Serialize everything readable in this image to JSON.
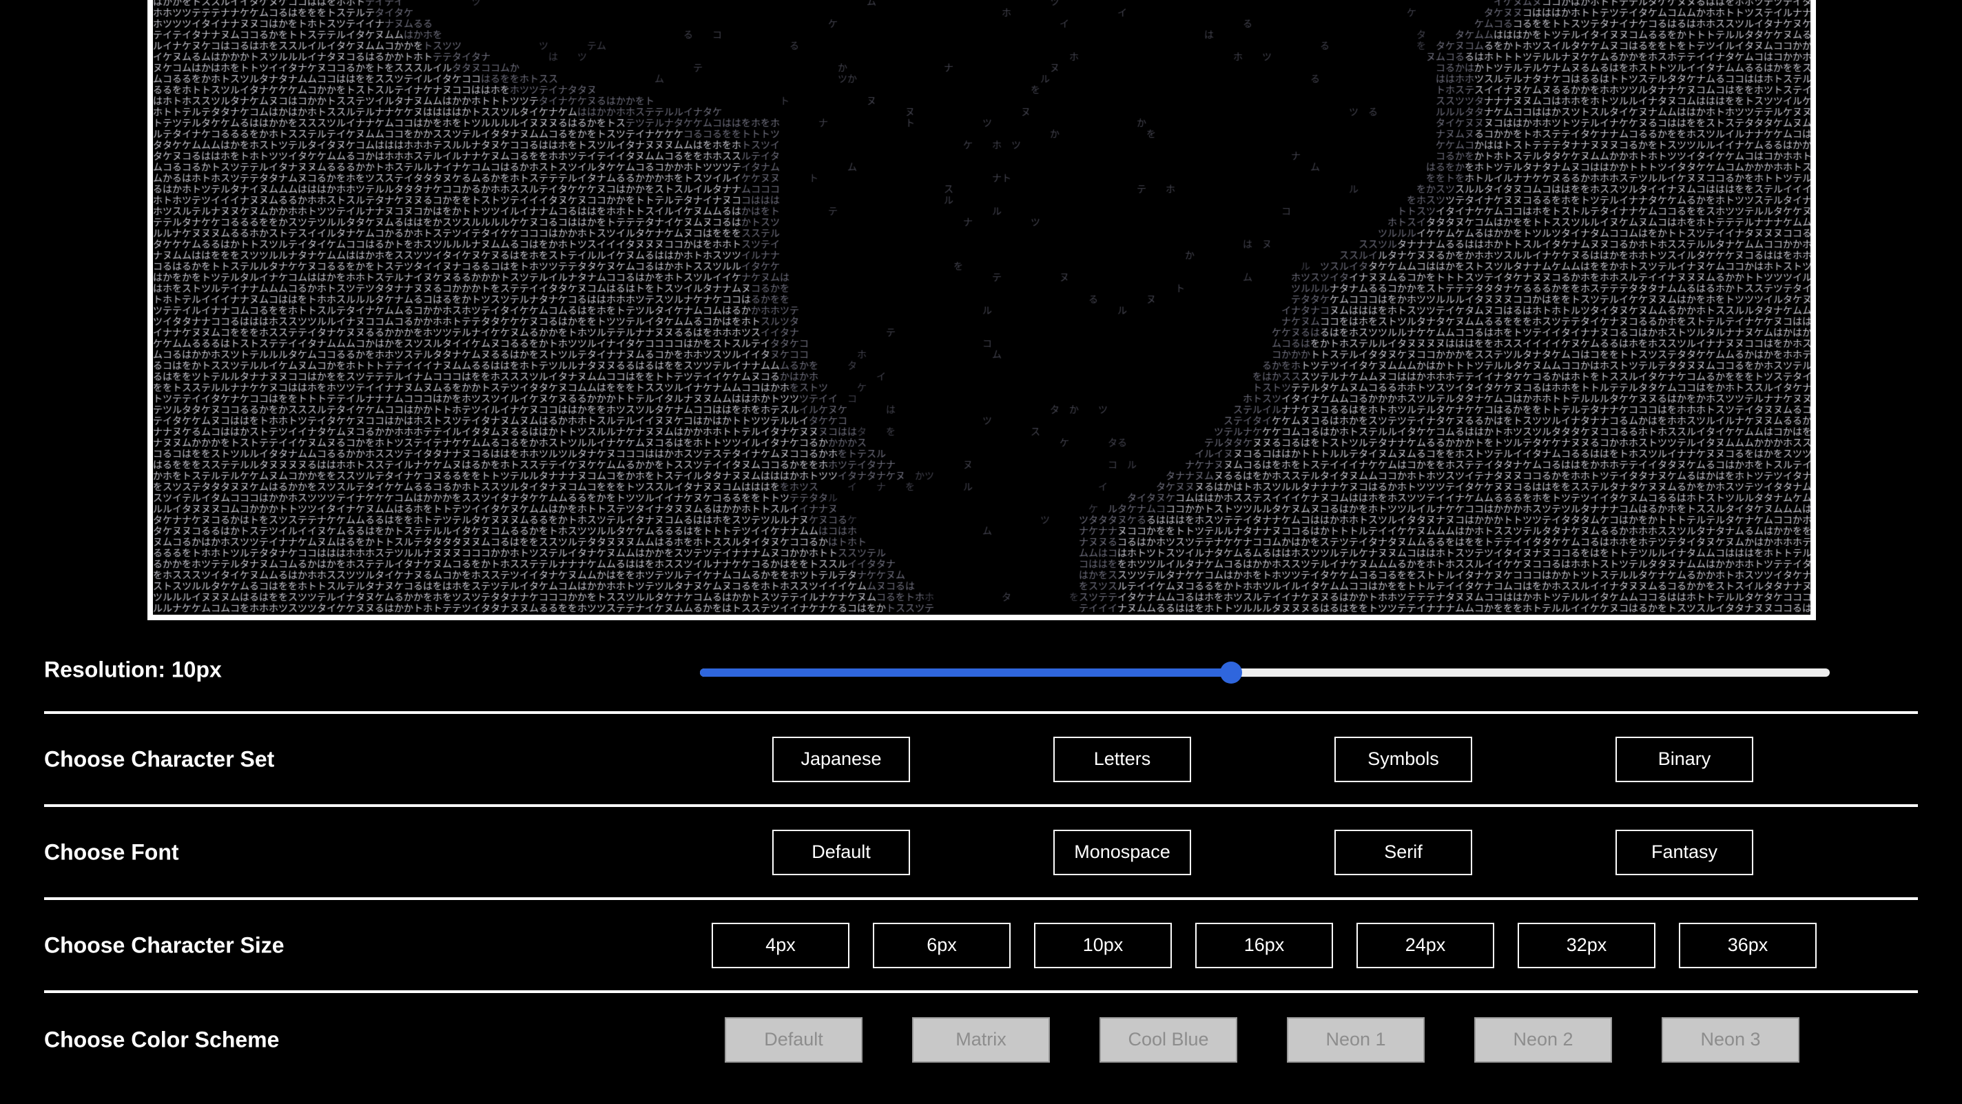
{
  "ascii_preview": {
    "charset_glyphs": "るはかをホトスツテルイタナケヌムコ",
    "glyph_color": "#c7c7d0"
  },
  "resolution": {
    "label": "Resolution: 10px",
    "value": 0.47,
    "accent_color": "#2f66dd"
  },
  "character_set": {
    "label": "Choose Character Set",
    "options": [
      "Japanese",
      "Letters",
      "Symbols",
      "Binary"
    ]
  },
  "font": {
    "label": "Choose Font",
    "options": [
      "Default",
      "Monospace",
      "Serif",
      "Fantasy"
    ]
  },
  "character_size": {
    "label": "Choose Character Size",
    "options": [
      "4px",
      "6px",
      "10px",
      "16px",
      "24px",
      "32px",
      "36px"
    ]
  },
  "color_scheme": {
    "label": "Choose Color Scheme",
    "options": [
      "Default",
      "Matrix",
      "Cool Blue",
      "Neon 1",
      "Neon 2",
      "Neon 3"
    ]
  }
}
